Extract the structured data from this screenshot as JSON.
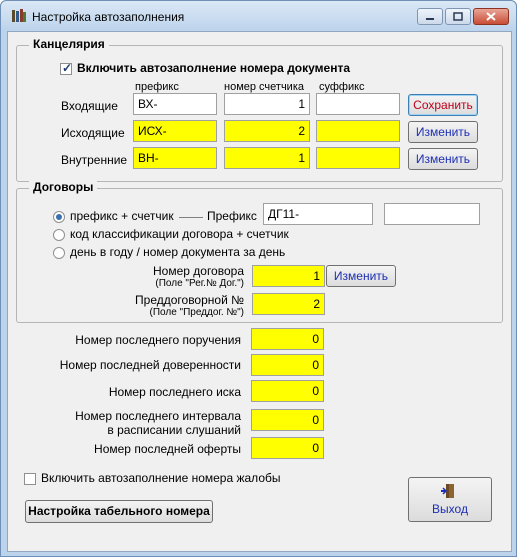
{
  "window": {
    "title": "Настройка автозаполнения"
  },
  "office": {
    "legend": "Канцелярия",
    "enable_label": "Включить автозаполнение номера документа",
    "enable_checked": true,
    "col_prefix": "префикс",
    "col_counter": "номер счетчика",
    "col_suffix": "суффикс",
    "rows": [
      {
        "label": "Входящие",
        "prefix": "ВХ-",
        "counter": "1",
        "suffix": "",
        "button": "Сохранить"
      },
      {
        "label": "Исходящие",
        "prefix": "ИСХ-",
        "counter": "2",
        "suffix": "",
        "button": "Изменить"
      },
      {
        "label": "Внутренние",
        "prefix": "ВН-",
        "counter": "1",
        "suffix": "",
        "button": "Изменить"
      }
    ]
  },
  "contracts": {
    "legend": "Договоры",
    "options": [
      "префикс + счетчик",
      "код классификации  договора + счетчик",
      "день в году / номер документа за день"
    ],
    "selected_option": 0,
    "prefix_label": "Префикс",
    "prefix_value": "ДГ11-",
    "suffix_value": "",
    "contract_number_label": "Номер договора",
    "contract_number_note": "(Поле \"Рег.№ Дог.\")",
    "contract_number_value": "1",
    "change_button": "Изменить",
    "pre_contract_label": "Преддоговорной №",
    "pre_contract_note": "(Поле \"Преддог. №\")",
    "pre_contract_value": "2"
  },
  "counters": [
    {
      "label": "Номер последнего поручения",
      "value": "0"
    },
    {
      "label": "Номер последней доверенности",
      "value": "0"
    },
    {
      "label": "Номер последнего иска",
      "value": "0"
    },
    {
      "label": "Номер последнего интервала\nв расписании слушаний",
      "value": "0"
    },
    {
      "label": "Номер последней оферты",
      "value": "0"
    }
  ],
  "complaint": {
    "label": "Включить автозаполнение номера жалобы",
    "checked": false
  },
  "buttons": {
    "tab_number": "Настройка табельного номера",
    "exit": "Выход"
  },
  "colors": {
    "highlight": "#ffff00",
    "accent_text": "#1c2fb5"
  }
}
